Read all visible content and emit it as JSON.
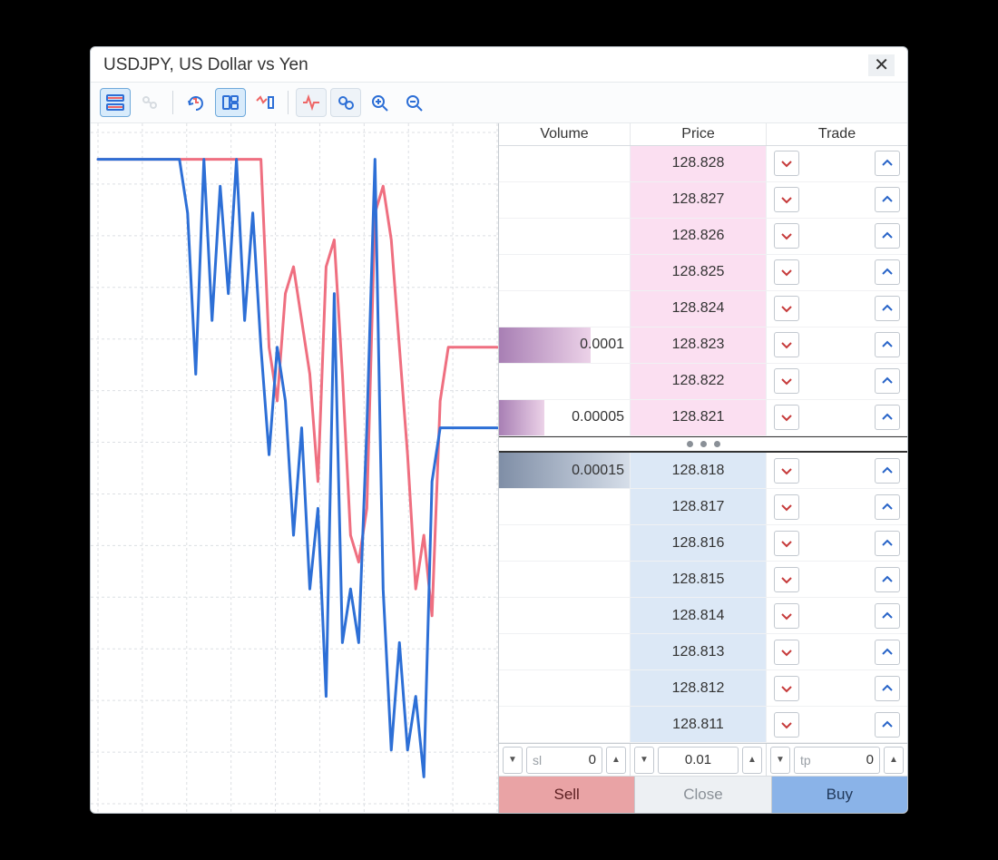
{
  "title": "USDJPY, US Dollar vs Yen",
  "toolbar": {
    "items": [
      {
        "name": "dom-view-icon",
        "active": true
      },
      {
        "name": "link-icon",
        "active": false,
        "dim": true
      },
      {
        "divider": true
      },
      {
        "name": "tick-history-icon",
        "active": false
      },
      {
        "name": "layout-icon",
        "active": true
      },
      {
        "name": "tick-chart-icon",
        "active": false
      },
      {
        "divider": true
      },
      {
        "name": "signal-icon",
        "active": false,
        "group": true
      },
      {
        "name": "bubbles-icon",
        "active": false,
        "group": true
      },
      {
        "name": "zoom-in-icon",
        "active": false
      },
      {
        "name": "zoom-out-icon",
        "active": false
      }
    ]
  },
  "dom": {
    "headers": {
      "volume": "Volume",
      "price": "Price",
      "trade": "Trade"
    },
    "ask": [
      {
        "price": "128.828",
        "volume": "",
        "bar": 0
      },
      {
        "price": "128.827",
        "volume": "",
        "bar": 0
      },
      {
        "price": "128.826",
        "volume": "",
        "bar": 0
      },
      {
        "price": "128.825",
        "volume": "",
        "bar": 0
      },
      {
        "price": "128.824",
        "volume": "",
        "bar": 0
      },
      {
        "price": "128.823",
        "volume": "0.0001",
        "bar": 70
      },
      {
        "price": "128.822",
        "volume": "",
        "bar": 0
      },
      {
        "price": "128.821",
        "volume": "0.00005",
        "bar": 35
      }
    ],
    "bid": [
      {
        "price": "128.818",
        "volume": "0.00015",
        "bar": 100
      },
      {
        "price": "128.817",
        "volume": "",
        "bar": 0
      },
      {
        "price": "128.816",
        "volume": "",
        "bar": 0
      },
      {
        "price": "128.815",
        "volume": "",
        "bar": 0
      },
      {
        "price": "128.814",
        "volume": "",
        "bar": 0
      },
      {
        "price": "128.813",
        "volume": "",
        "bar": 0
      },
      {
        "price": "128.812",
        "volume": "",
        "bar": 0
      },
      {
        "price": "128.811",
        "volume": "",
        "bar": 0
      }
    ]
  },
  "steppers": {
    "sl": {
      "placeholder": "sl",
      "value": "0"
    },
    "lot": {
      "placeholder": "",
      "value": "0.01"
    },
    "tp": {
      "placeholder": "tp",
      "value": "0"
    }
  },
  "actions": {
    "sell": "Sell",
    "close": "Close",
    "buy": "Buy"
  },
  "colors": {
    "ask": "#ef6f80",
    "bid": "#2d6fd6",
    "askVolBar": "linear-gradient(90deg,#b48abf,#e6c7e2)",
    "bidVolBar": "linear-gradient(90deg,#8595ac,#d2dbe8)"
  },
  "chart_data": {
    "type": "line",
    "x": [
      0,
      1,
      2,
      3,
      4,
      5,
      6,
      7,
      8,
      9,
      10,
      11,
      12,
      13,
      14,
      15,
      16,
      17,
      18,
      19,
      20,
      21,
      22,
      23,
      24,
      25,
      26,
      27,
      28,
      29,
      30,
      31,
      32,
      33,
      34,
      35,
      36,
      37,
      38,
      39,
      40,
      41,
      42,
      43,
      44,
      45,
      46,
      47,
      48,
      49
    ],
    "series": [
      {
        "name": "ask",
        "color": "#ef6f80",
        "values": [
          128.828,
          128.828,
          128.828,
          128.828,
          128.828,
          128.828,
          128.828,
          128.828,
          128.828,
          128.828,
          128.828,
          128.828,
          128.828,
          128.828,
          128.828,
          128.828,
          128.828,
          128.828,
          128.828,
          128.828,
          128.828,
          128.821,
          128.819,
          128.823,
          128.824,
          128.822,
          128.82,
          128.816,
          128.824,
          128.825,
          128.82,
          128.814,
          128.813,
          128.815,
          128.826,
          128.827,
          128.825,
          128.821,
          128.817,
          128.812,
          128.814,
          128.811,
          128.819,
          128.821,
          128.821,
          128.821,
          128.821,
          128.821,
          128.821,
          128.821
        ]
      },
      {
        "name": "bid",
        "color": "#2d6fd6",
        "values": [
          128.828,
          128.828,
          128.828,
          128.828,
          128.828,
          128.828,
          128.828,
          128.828,
          128.828,
          128.828,
          128.828,
          128.826,
          128.82,
          128.828,
          128.822,
          128.827,
          128.823,
          128.828,
          128.822,
          128.826,
          128.821,
          128.817,
          128.821,
          128.819,
          128.814,
          128.818,
          128.812,
          128.815,
          128.808,
          128.823,
          128.81,
          128.812,
          128.81,
          128.818,
          128.828,
          128.812,
          128.806,
          128.81,
          128.806,
          128.808,
          128.805,
          128.816,
          128.818,
          128.818,
          128.818,
          128.818,
          128.818,
          128.818,
          128.818,
          128.818
        ]
      }
    ],
    "ylim": [
      128.804,
      128.829
    ],
    "xlabel": "",
    "ylabel": "",
    "title": ""
  }
}
